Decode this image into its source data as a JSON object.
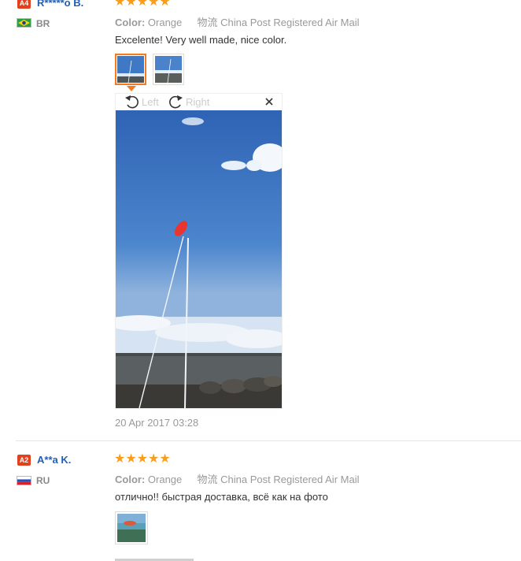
{
  "review1": {
    "badge": "A4",
    "name": "R*****o B.",
    "country": "BR",
    "color_label": "Color:",
    "color_value": "Orange",
    "shipping_label": "物流",
    "shipping_value": "China Post Registered Air Mail",
    "text": "Excelente! Very well made, nice color.",
    "rotate_left_label": "Left",
    "rotate_right_label": "Right",
    "date": "20 Apr 2017 03:28",
    "rating": 5
  },
  "review2": {
    "badge": "A2",
    "name": "A**a K.",
    "country": "RU",
    "color_label": "Color:",
    "color_value": "Orange",
    "shipping_label": "物流",
    "shipping_value": "China Post Registered Air Mail",
    "text": "отлично!! быстрая доставка, всё как на фото",
    "rating": 5
  },
  "colors": {
    "star": "#f99e1a",
    "name_link": "#1f5fb5",
    "badge": "#e0411f",
    "active_thumb": "#f47a20"
  },
  "icons": [
    "rotate-left-icon",
    "rotate-right-icon",
    "close-icon",
    "star-icon",
    "flag-icon"
  ]
}
